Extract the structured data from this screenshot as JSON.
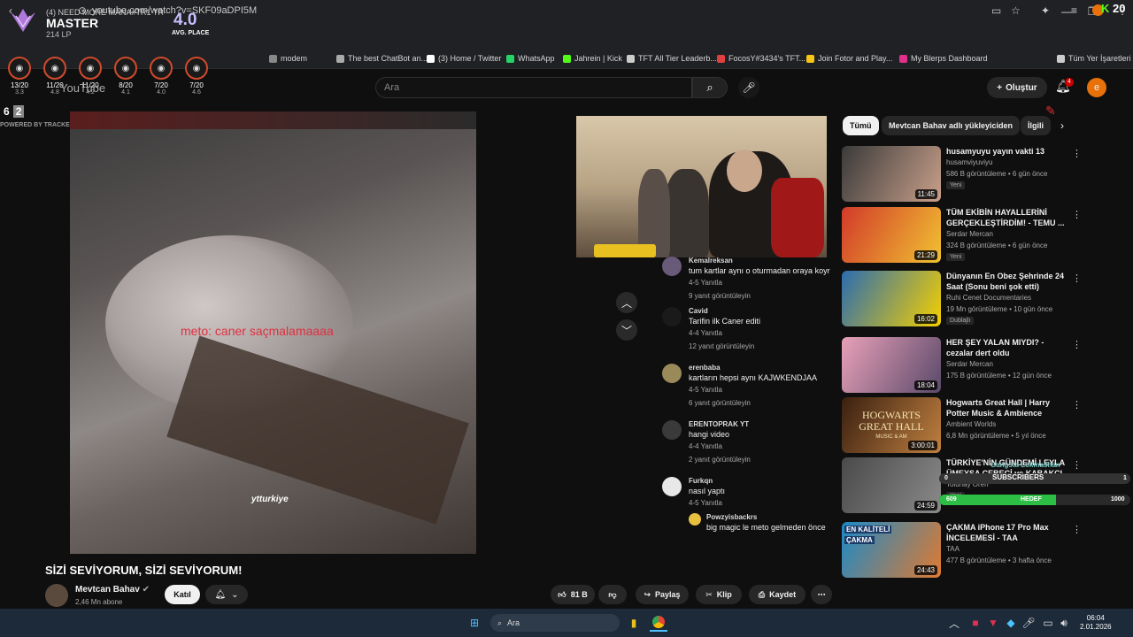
{
  "tft": {
    "status_top": "(4) NEED MORE MANA#TR1 TR",
    "rank": "MASTER",
    "lp": "214 LP",
    "avg_value": "4.0",
    "avg_label": "AVG. PLACE",
    "games": [
      {
        "place": "13/20",
        "avg": "3.3"
      },
      {
        "place": "11/20",
        "avg": "4.8"
      },
      {
        "place": "11/20",
        "avg": "4.2"
      },
      {
        "place": "8/20",
        "avg": "4.1"
      },
      {
        "place": "7/20",
        "avg": "4.0"
      },
      {
        "place": "7/20",
        "avg": "4.6"
      }
    ],
    "box_left": "6",
    "box_right": "2",
    "powered": "POWERED BY TRACKER.GG/TFT"
  },
  "kick": {
    "k": "K",
    "count": "20"
  },
  "browser": {
    "url": "youtube.com/watch?v=SKF09aDPI5M",
    "bookmarks": [
      "modem",
      "The best ChatBot an...",
      "(3) Home / Twitter",
      "WhatsApp",
      "Jahrein | Kick",
      "TFT All Tier Leaderb...",
      "FocosY#3434's TFT...",
      "Join Fotor and Play...",
      "My Blerps Dashboard",
      "Tüm Yer İşaretleri"
    ],
    "bookmark_colors": [
      "#888888",
      "#aaaaaa",
      "#ffffff",
      "#25d366",
      "#53fc18",
      "#cccccc",
      "#e04040",
      "#f5c518",
      "#e0308a",
      "#cccccc"
    ]
  },
  "yt": {
    "logo": "YouTube",
    "search_placeholder": "Ara",
    "create": "Oluştur",
    "bell_count": "4",
    "avatar_letter": "e"
  },
  "video": {
    "caption": "meto: caner saçmalamaaaa",
    "watermark": "ytturkiye",
    "title": "SİZİ SEVİYORUM, SİZİ SEVİYORUM!",
    "channel": "Mevtcan Bahav",
    "subs": "2,46 Mn abone",
    "join": "Katıl",
    "likes": "81 B",
    "share": "Paylaş",
    "clip": "Klip",
    "save": "Kaydet"
  },
  "chat": [
    {
      "name": "Kemalreksan",
      "text": "tum kartlar aynı o oturmadan oraya koyr",
      "meta": "4-5  Yanıtla",
      "replies": "9 yanıt görüntüleyin"
    },
    {
      "name": "Cavid",
      "text": "Tarifin ilk Caner editi",
      "meta": "4-4  Yanıtla",
      "replies": "12 yanıt görüntüleyin"
    },
    {
      "name": "erenbaba",
      "text": "kartların hepsi aynı KAJWKENDJAA",
      "meta": "4-5  Yanıtla",
      "replies": "6 yanıt görüntüleyin"
    },
    {
      "name": "ERENTOPRAK YT",
      "text": "hangi video",
      "meta": "4-4  Yanıtla",
      "replies": "2 yanıt görüntüleyin"
    },
    {
      "name": "Furkqn",
      "text": "nasıl yaptı",
      "meta": "4-5  Yanıtla",
      "replies": ""
    }
  ],
  "reply": {
    "name": "Powzyisbackrs",
    "text": "big magic le meto gelmeden önce"
  },
  "chips": [
    "Tümü",
    "Mevtcan Bahav adlı yükleyiciden",
    "İlgili"
  ],
  "recommendations": [
    {
      "title": "husamyuyu yayın vakti 13",
      "channel": "husamviyuviyu",
      "meta": "586 B görüntüleme • 6 gün önce",
      "badge": "Yeni",
      "duration": "11:45",
      "colors": [
        "#3a3a3a",
        "#c9a08a"
      ]
    },
    {
      "title": "TÜM EKİBİN HAYALLERİNİ GERÇEKLEŞTİRDİM! - TEMU ...",
      "channel": "Serdar Mercan",
      "meta": "324 B görüntüleme • 6 gün önce",
      "badge": "Yeni",
      "duration": "21:29",
      "colors": [
        "#d23a2a",
        "#f1c232"
      ]
    },
    {
      "title": "Dünyanın En Obez Şehrinde 24 Saat (Sonu beni şok etti)",
      "channel": "Ruhi Cenet Documentaries",
      "meta": "19 Mn görüntüleme • 10 gün önce",
      "badge": "Dublajlı",
      "duration": "16:02",
      "colors": [
        "#2b6cb0",
        "#f5d000"
      ]
    },
    {
      "title": "HER ŞEY YALAN MIYDI? - cezalar dert oldu",
      "channel": "Serdar Mercan",
      "meta": "175 B görüntüleme • 12 gün önce",
      "badge": "",
      "duration": "18:04",
      "colors": [
        "#e8a0b8",
        "#5a4a6a"
      ]
    },
    {
      "title": "Hogwarts Great Hall | Harry Potter Music & Ambience",
      "channel": "Ambient Worlds",
      "meta": "6,8 Mn görüntüleme • 5 yıl önce",
      "badge": "",
      "duration": "3:00:01",
      "colors": [
        "#3a2010",
        "#c08040"
      ]
    },
    {
      "title": "TÜRKİYE'NİN GÜNDEMİ LEYLA ÜMEYSA CEBECİ ve KABAKÇI",
      "channel": "Tolunay Ören",
      "meta": "",
      "badge": "Yeni",
      "duration": "24:59",
      "colors": [
        "#4a4a4a",
        "#8a8a8a"
      ]
    },
    {
      "title": "ÇAKMA iPhone 17 Pro Max İNCELEMESİ - TAA",
      "channel": "TAA",
      "meta": "477 B görüntüleme • 3 hafta önce",
      "badge": "",
      "duration": "24:43",
      "colors": [
        "#1a8ac9",
        "#e07a30"
      ]
    }
  ],
  "thumb_text": {
    "hogwarts": "HOGWARTS GREAT HALL",
    "hogwarts_sub": "MUSIC & AM",
    "cakma1": "EN KALİTELİ",
    "cakma2": "ÇAKMA"
  },
  "sub_overlay": {
    "name": "Gangsta Lokmashan",
    "label": "SUBSCRIBERS",
    "left": "0",
    "right": "1",
    "goal_left": "609",
    "goal_label": "HEDEF",
    "goal_right": "1000",
    "progress": 0.609
  },
  "taskbar": {
    "search": "Ara",
    "time": "06:04",
    "date": "2.01.2026"
  }
}
